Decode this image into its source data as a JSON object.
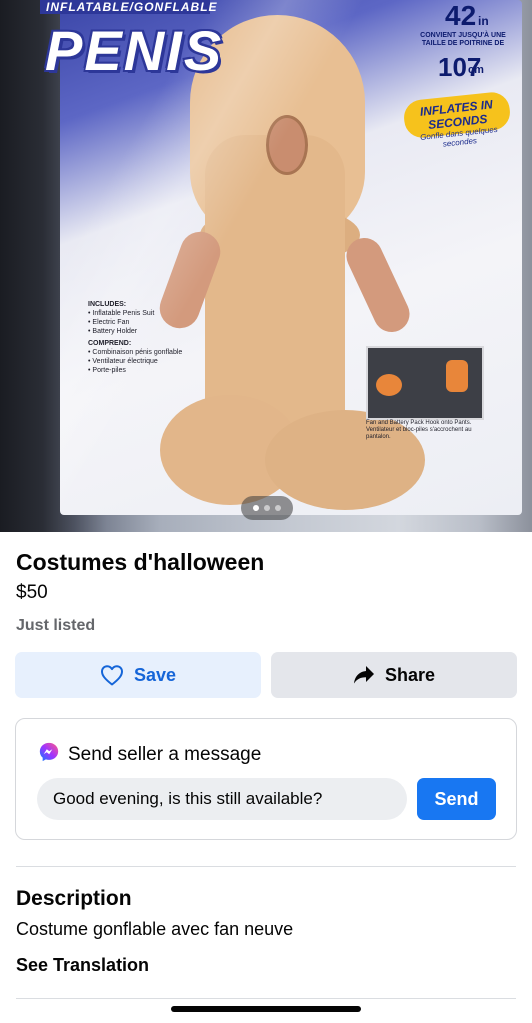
{
  "photo": {
    "package_banner": "INFLATABLE/GONFLABLE",
    "package_brand": "PENIS",
    "size_number": "42",
    "size_unit": "in",
    "size_note": "CONVIENT JUSQU'À UNE TAILLE DE POITRINE DE",
    "size_cm": "107",
    "size_cm_unit": "cm",
    "inflates_en": "INFLATES IN SECONDS",
    "inflates_fr": "Gonfle dans quelques secondes",
    "includes_header": "INCLUDES:",
    "includes_items": [
      "• Inflatable Penis Suit",
      "• Electric Fan",
      "• Battery Holder"
    ],
    "comprend_header": "COMPREND:",
    "comprend_items": [
      "• Combinaison pénis gonflable",
      "• Ventilateur électrique",
      "• Porte-piles"
    ],
    "inset_caption": "Fan and Battery Pack Hook onto Pants. Ventilateur et bloc-piles s'accrochent au pantalon.",
    "pager_count": 3,
    "pager_active_index": 0
  },
  "listing": {
    "title": "Costumes d'halloween",
    "price": "$50",
    "status": "Just listed"
  },
  "actions": {
    "save_label": "Save",
    "share_label": "Share"
  },
  "message": {
    "title": "Send seller a message",
    "input_value": "Good evening, is this still available?",
    "send_label": "Send"
  },
  "description": {
    "header": "Description",
    "body": "Costume gonflable avec fan neuve",
    "see_translation": "See Translation"
  },
  "colors": {
    "accent": "#1877f2",
    "save_bg": "#e7f0fd",
    "save_text": "#1565d8",
    "muted_text": "#65676b"
  },
  "icons": {
    "save": "heart-outline-icon",
    "share": "share-arrow-icon",
    "messenger": "messenger-icon"
  }
}
